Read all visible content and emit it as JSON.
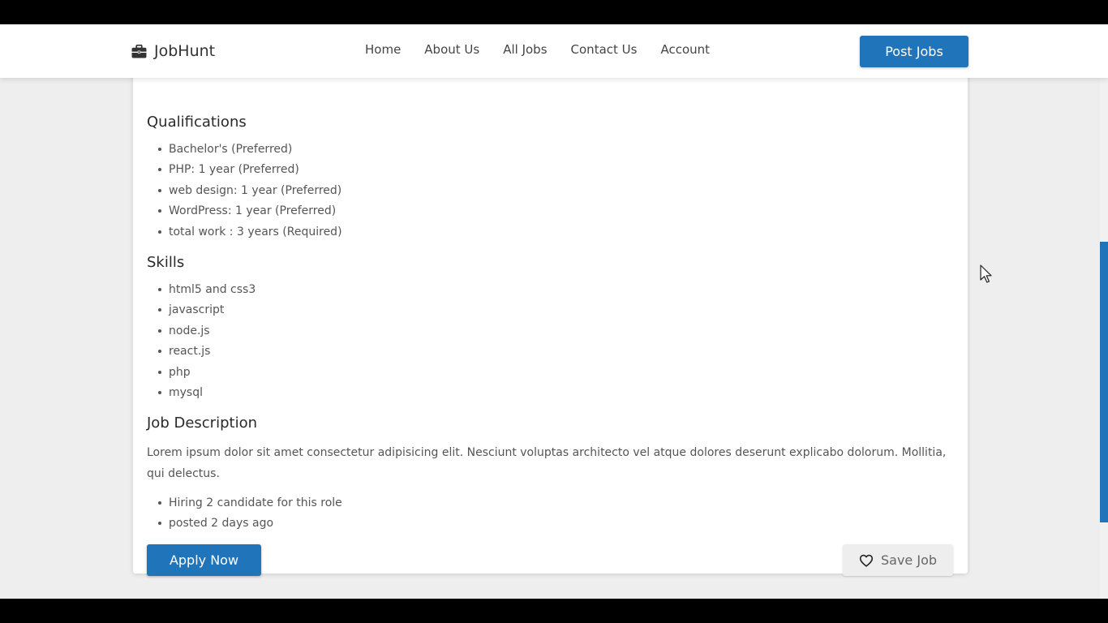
{
  "navbar": {
    "brand": "JobHunt",
    "brand_icon": "briefcase-icon",
    "links": [
      "Home",
      "About Us",
      "All Jobs",
      "Contact Us",
      "Account"
    ],
    "post_button": "Post Jobs"
  },
  "qualifications": {
    "title": "Qualifications",
    "items": [
      "Bachelor's (Preferred)",
      "PHP: 1 year (Preferred)",
      "web design: 1 year (Preferred)",
      "WordPress: 1 year (Preferred)",
      "total work : 3 years (Required)"
    ]
  },
  "skills": {
    "title": "Skills",
    "items": [
      "html5 and css3",
      "javascript",
      "node.js",
      "react.js",
      "php",
      "mysql"
    ]
  },
  "job_description": {
    "title": "Job Description",
    "text": "Lorem ipsum dolor sit amet consectetur adipisicing elit. Nesciunt voluptas architecto vel atque dolores deserunt explicabo dolorum. Mollitia, qui delectus.",
    "meta": [
      "Hiring 2 candidate for this role",
      "posted 2 days ago"
    ]
  },
  "actions": {
    "apply": "Apply Now",
    "save": "Save Job",
    "save_icon": "heart-icon"
  },
  "colors": {
    "accent": "#1f74ba",
    "background": "#eeeeee"
  }
}
